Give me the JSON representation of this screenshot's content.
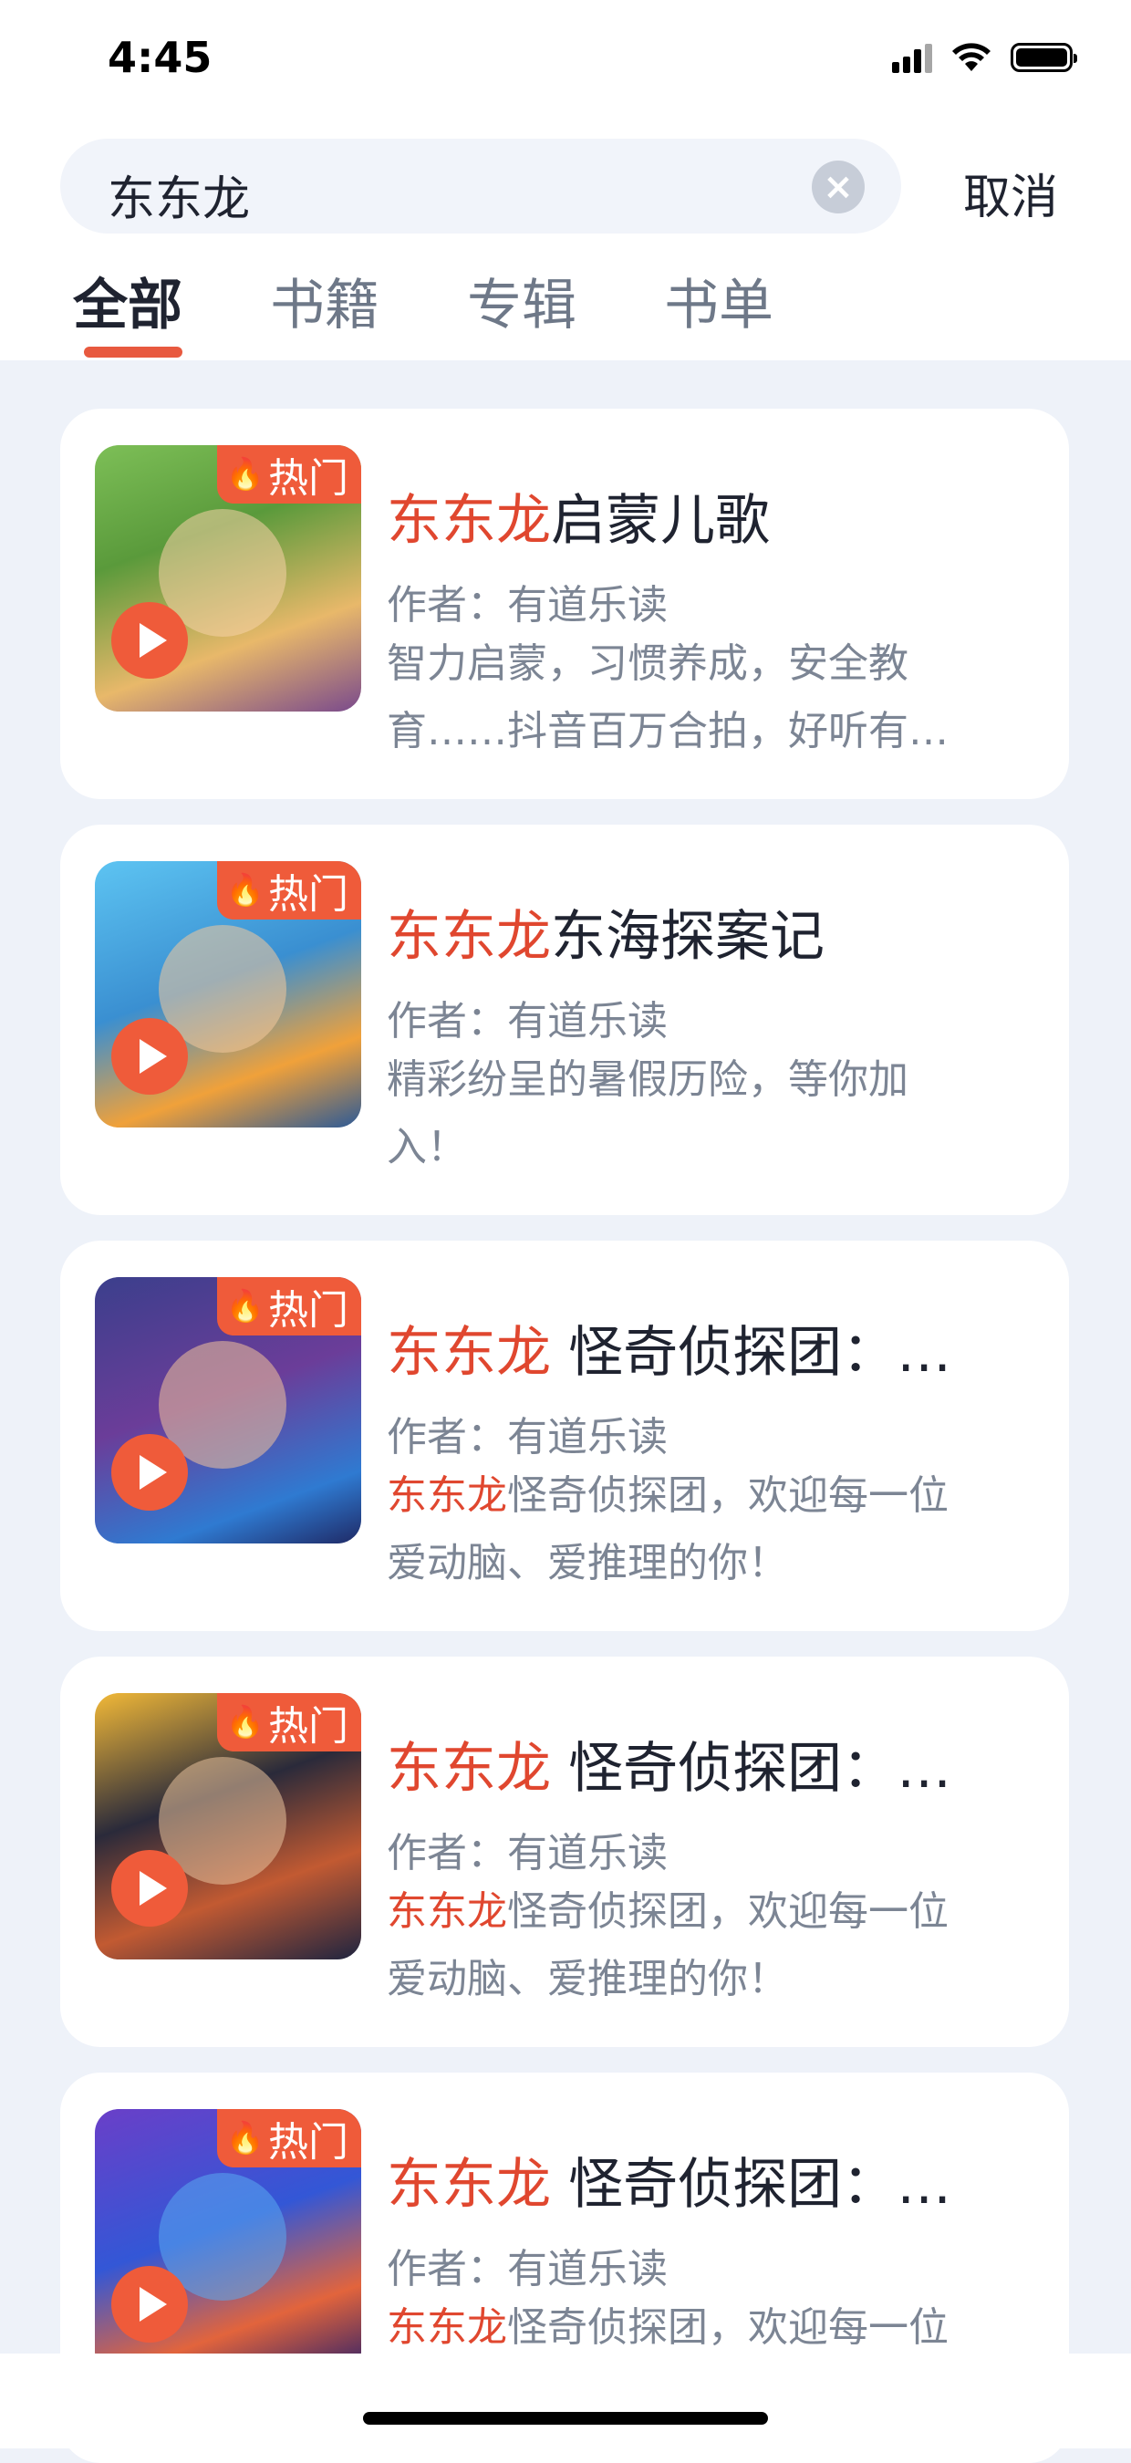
{
  "status_bar": {
    "time": "4:45"
  },
  "search": {
    "query": "东东龙",
    "clear_label": "×",
    "cancel_label": "取消"
  },
  "tabs": [
    {
      "label": "全部"
    },
    {
      "label": "书籍"
    },
    {
      "label": "专辑"
    },
    {
      "label": "书单"
    }
  ],
  "results": [
    {
      "hot_label": "热门",
      "title_highlight": "东东龙",
      "title_rest": "启蒙儿歌",
      "author": "作者：有道乐读",
      "desc_highlight": "",
      "desc_line1": "智力启蒙，习惯养成，安全教",
      "desc_line2": "育……抖音百万合拍，好听有…"
    },
    {
      "hot_label": "热门",
      "title_highlight": "东东龙",
      "title_rest": "东海探案记",
      "author": "作者：有道乐读",
      "desc_highlight": "",
      "desc_line1": "精彩纷呈的暑假历险，等你加",
      "desc_line2": "入！"
    },
    {
      "hot_label": "热门",
      "title_highlight": "东东龙",
      "title_rest": " 怪奇侦探团：…",
      "author": "作者：有道乐读",
      "desc_highlight": "东东龙",
      "desc_line1": "怪奇侦探团，欢迎每一位",
      "desc_line2": "爱动脑、爱推理的你！"
    },
    {
      "hot_label": "热门",
      "title_highlight": "东东龙",
      "title_rest": " 怪奇侦探团：…",
      "author": "作者：有道乐读",
      "desc_highlight": "东东龙",
      "desc_line1": "怪奇侦探团，欢迎每一位",
      "desc_line2": "爱动脑、爱推理的你！"
    },
    {
      "hot_label": "热门",
      "title_highlight": "东东龙",
      "title_rest": " 怪奇侦探团：…",
      "author": "作者：有道乐读",
      "desc_highlight": "东东龙",
      "desc_line1": "怪奇侦探团，欢迎每一位",
      "desc_line2": ""
    }
  ]
}
